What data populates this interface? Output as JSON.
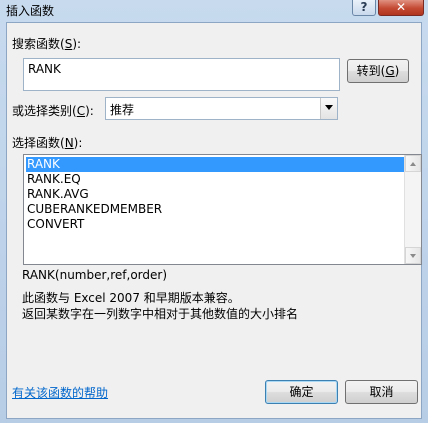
{
  "window": {
    "title": "插入函数",
    "help_glyph": "?",
    "close_glyph": "✕"
  },
  "search": {
    "label_pre": "搜索函数(",
    "label_key": "S",
    "label_post": "):",
    "value": "RANK",
    "goto_pre": "转到(",
    "goto_key": "G",
    "goto_post": ")"
  },
  "category": {
    "label_pre": "或选择类别(",
    "label_key": "C",
    "label_post": "):",
    "selected": "推荐"
  },
  "functions": {
    "label_pre": "选择函数(",
    "label_key": "N",
    "label_post": "):",
    "items": [
      "RANK",
      "RANK.EQ",
      "RANK.AVG",
      "CUBERANKEDMEMBER",
      "CONVERT"
    ],
    "selected_index": 0
  },
  "details": {
    "signature": "RANK(number,ref,order)",
    "line1": "此函数与 Excel 2007 和早期版本兼容。",
    "line2": "返回某数字在一列数字中相对于其他数值的大小排名"
  },
  "footer": {
    "help_link": "有关该函数的帮助",
    "ok": "确定",
    "cancel": "取消"
  }
}
